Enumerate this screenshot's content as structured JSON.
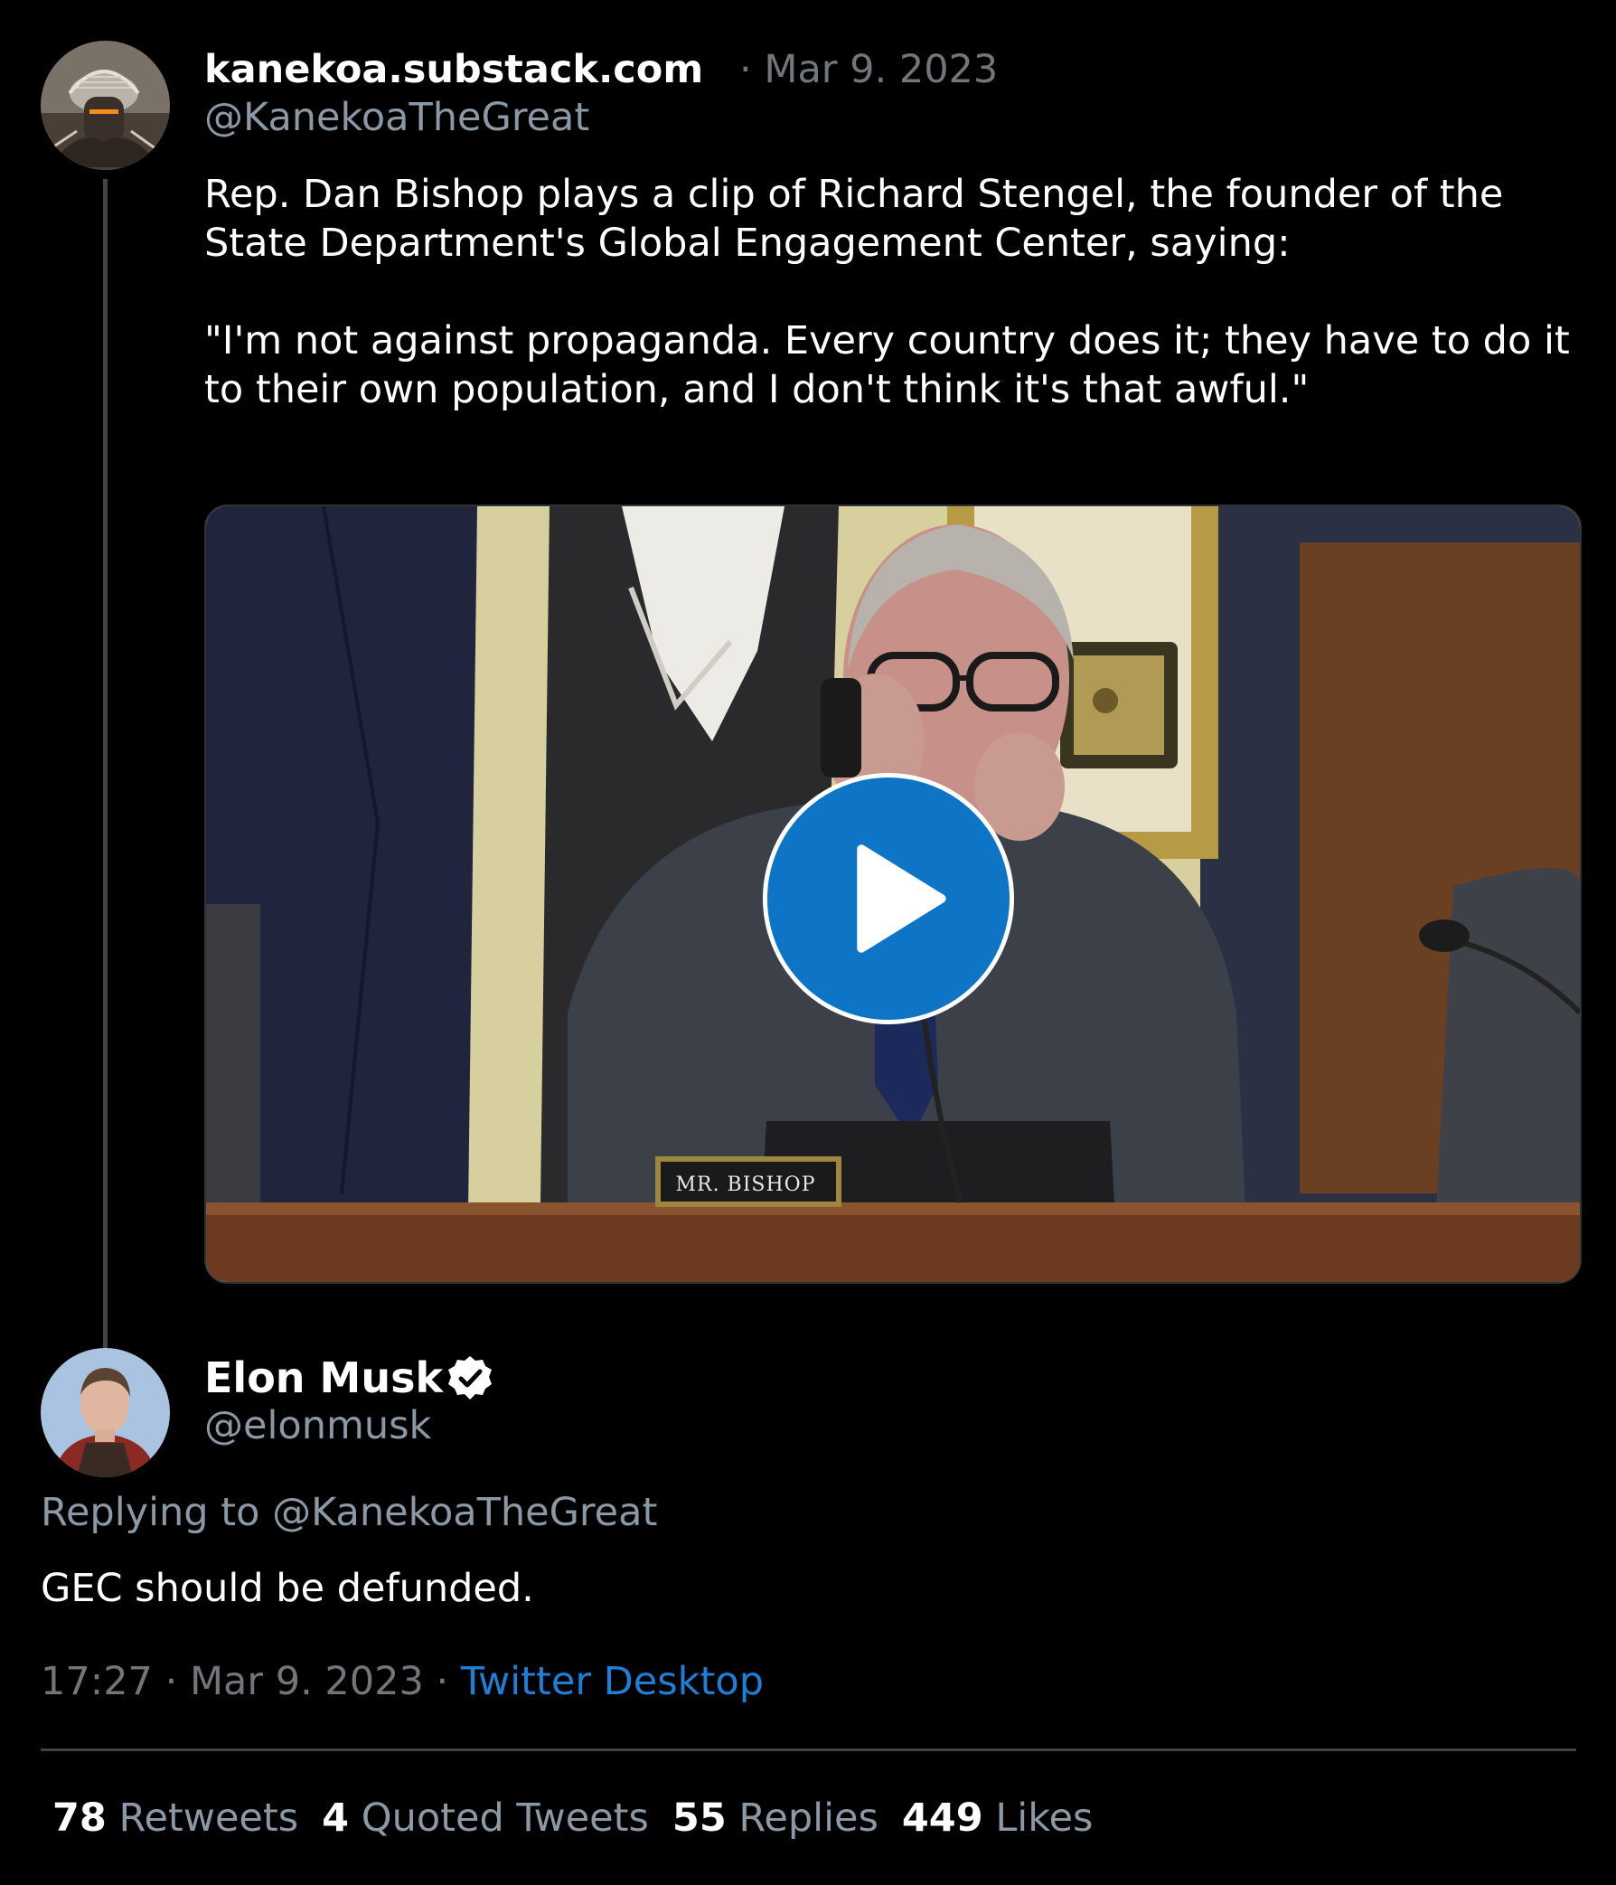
{
  "original_tweet": {
    "display_name": "kanekoa.substack.com",
    "separator": "·",
    "date": "Mar 9. 2023",
    "handle": "@KanekoaTheGreat",
    "text_intro": "Rep. Dan Bishop plays a clip of Richard Stengel, the founder of the State Department's Global Engagement Center, saying:",
    "text_quote": "\"I'm not against propaganda. Every country does it; they have to do it to their own population, and I don't think it's that awful.\"",
    "video": {
      "nameplate": "MR. BISHOP",
      "play_icon": "play-icon",
      "play_color": "#0d74c6"
    }
  },
  "reply_tweet": {
    "display_name": "Elon Musk",
    "verified_icon": "verified-badge-icon",
    "handle": "@elonmusk",
    "replying_prefix": "Replying to ",
    "replying_to": "@KanekoaTheGreat",
    "text": "GEC should be defunded.",
    "time": "17:27",
    "dot": "·",
    "date": "Mar 9. 2023",
    "source": "Twitter Desktop",
    "source_color": "#1d7fd6"
  },
  "stats": {
    "retweets": {
      "count": "78",
      "label": "Retweets"
    },
    "quotes": {
      "count": "4",
      "label": "Quoted Tweets"
    },
    "replies": {
      "count": "55",
      "label": "Replies"
    },
    "likes": {
      "count": "449",
      "label": "Likes"
    }
  }
}
